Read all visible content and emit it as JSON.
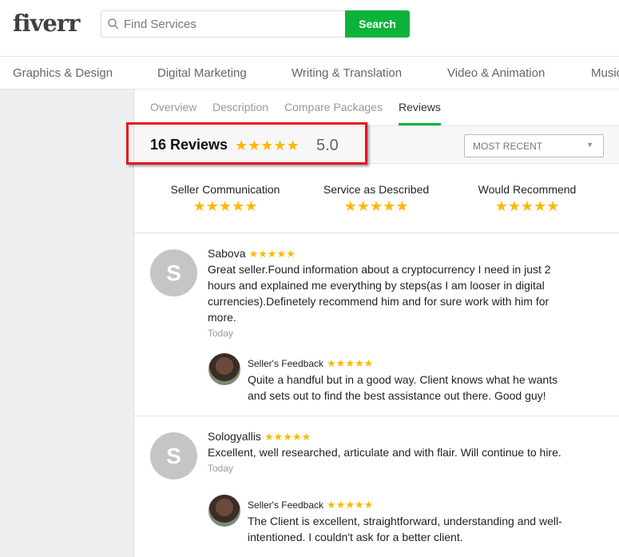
{
  "header": {
    "logo": "fiverr",
    "search_placeholder": "Find Services",
    "search_button": "Search"
  },
  "nav": [
    "Graphics & Design",
    "Digital Marketing",
    "Writing & Translation",
    "Video & Animation",
    "Music"
  ],
  "tabs": [
    {
      "label": "Overview"
    },
    {
      "label": "Description"
    },
    {
      "label": "Compare Packages"
    },
    {
      "label": "Reviews",
      "active": true
    }
  ],
  "summary": {
    "count": "16 Reviews",
    "stars": "★★★★★",
    "score": "5.0",
    "sort": "MOST RECENT"
  },
  "categories": [
    {
      "label": "Seller Communication",
      "stars": "★★★★★"
    },
    {
      "label": "Service as Described",
      "stars": "★★★★★"
    },
    {
      "label": "Would Recommend",
      "stars": "★★★★★"
    }
  ],
  "reviews": [
    {
      "initial": "S",
      "name": "Sabova",
      "stars": "★★★★★",
      "text": "Great seller.Found information about a cryptocurrency I need in just 2 hours and explained me everything by steps(as I am looser in digital currencies).Definetely recommend him and for sure work with him for more.",
      "date": "Today",
      "feedback_label": "Seller's Feedback",
      "feedback_stars": "★★★★★",
      "feedback": "Quite a handful but in a good way. Client knows what he wants and sets out to find the best assistance out there. Good guy!"
    },
    {
      "initial": "S",
      "name": "Sologyallis",
      "stars": "★★★★★",
      "text": "Excellent, well researched, articulate and with flair. Will continue to hire.",
      "date": "Today",
      "feedback_label": "Seller's Feedback",
      "feedback_stars": "★★★★★",
      "feedback": "The Client is excellent, straightforward, understanding and well-intentioned. I couldn't ask for a better client."
    }
  ],
  "colors": {
    "accent": "#0cb33a",
    "star": "#ffb800",
    "highlight": "#e8141b"
  }
}
